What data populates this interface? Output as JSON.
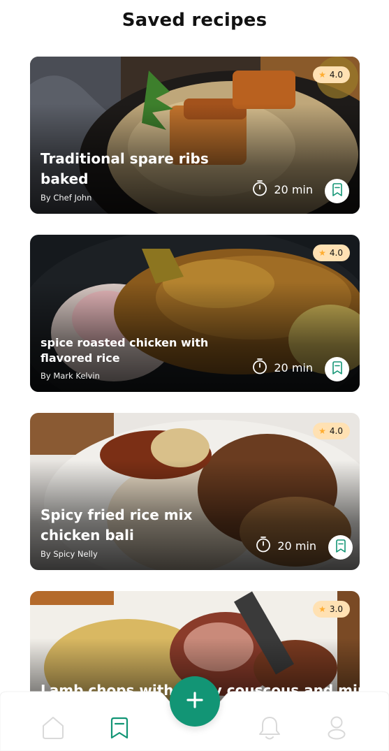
{
  "header": {
    "title": "Saved recipes"
  },
  "recipes": [
    {
      "title": "Traditional spare ribs baked",
      "author": "By Chef John",
      "time": "20 min",
      "rating": "4.0"
    },
    {
      "title": "spice roasted chicken with flavored rice",
      "author": "By Mark Kelvin",
      "time": "20 min",
      "rating": "4.0"
    },
    {
      "title": "Spicy fried rice mix chicken bali",
      "author": "By Spicy Nelly",
      "time": "20 min",
      "rating": "4.0"
    },
    {
      "title": "Lamb chops with fruity couscous and mint",
      "author": "",
      "time": "",
      "rating": "3.0"
    }
  ],
  "nav": {
    "items": [
      {
        "icon": "home-icon",
        "active": false
      },
      {
        "icon": "bookmark-icon",
        "active": true
      },
      {
        "icon": "bell-icon",
        "active": false
      },
      {
        "icon": "profile-icon",
        "active": false
      }
    ],
    "fab_icon": "plus-icon"
  },
  "colors": {
    "primary": "#129575",
    "rating_bg": "#FFE1B3",
    "star": "#FFAD30",
    "text": "#121212"
  }
}
